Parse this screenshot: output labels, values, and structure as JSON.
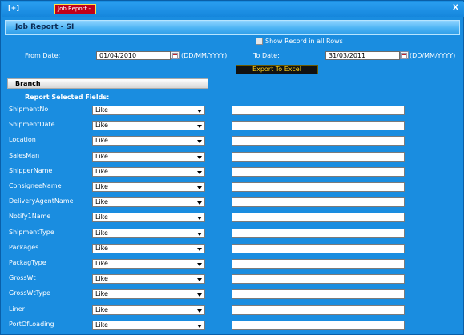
{
  "topbar": {
    "expand_label": "[+]",
    "tab_label": "Job Report -",
    "close_label": "X"
  },
  "title": "Job Report - SI",
  "show_all_rows_label": "Show Record in all Rows",
  "from": {
    "label": "From Date:",
    "value": "01/04/2010",
    "format": "(DD/MM/YYYY)"
  },
  "to": {
    "label": "To Date:",
    "value": "31/03/2011",
    "format": "(DD/MM/YYYY)"
  },
  "export_label": "Export To Excel",
  "branch_label": "Branch",
  "report_fields_label": "Report Selected Fields:",
  "fields": [
    {
      "name": "ShipmentNo",
      "op": "Like"
    },
    {
      "name": "ShipmentDate",
      "op": "Like"
    },
    {
      "name": "Location",
      "op": "Like"
    },
    {
      "name": "SalesMan",
      "op": "Like"
    },
    {
      "name": "ShipperName",
      "op": "Like"
    },
    {
      "name": "ConsigneeName",
      "op": "Like"
    },
    {
      "name": "DeliveryAgentName",
      "op": "Like"
    },
    {
      "name": "Notify1Name",
      "op": "Like"
    },
    {
      "name": "ShipmentType",
      "op": "Like"
    },
    {
      "name": "Packages",
      "op": "Like"
    },
    {
      "name": "PackagType",
      "op": "Like"
    },
    {
      "name": "GrossWt",
      "op": "Like"
    },
    {
      "name": "GrossWtType",
      "op": "Like"
    },
    {
      "name": "Liner",
      "op": "Like"
    },
    {
      "name": "PortOfLoading",
      "op": "Like"
    }
  ],
  "colors": {
    "background": "#1a8de0",
    "tab": "#c0001a",
    "export_text": "#ffd21a"
  }
}
